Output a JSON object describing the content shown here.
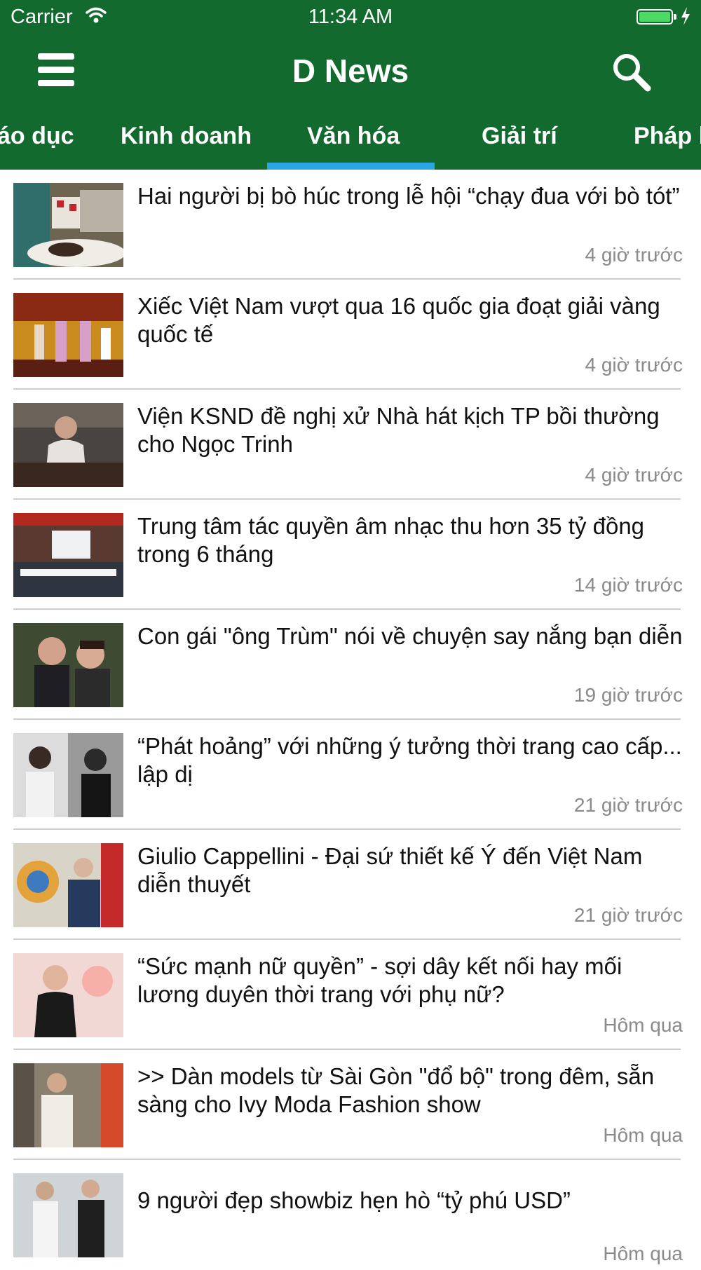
{
  "status_bar": {
    "carrier": "Carrier",
    "time": "11:34 AM"
  },
  "header": {
    "title": "D News"
  },
  "tabs": [
    {
      "label": "áo dục"
    },
    {
      "label": "Kinh doanh"
    },
    {
      "label": "Văn hóa"
    },
    {
      "label": "Giải trí"
    },
    {
      "label": "Pháp l"
    }
  ],
  "selected_tab": "Văn hóa",
  "colors": {
    "header_bg": "#126a2e",
    "tab_indicator": "#29a5e6",
    "time_text": "#8a8a8a"
  },
  "articles": [
    {
      "title": "Hai người bị bò húc trong lễ hội “chạy đua với bò tót”",
      "time": "4 giờ trước"
    },
    {
      "title": "Xiếc Việt Nam vượt qua 16 quốc gia đoạt giải vàng quốc tế",
      "time": "4 giờ trước"
    },
    {
      "title": "Viện KSND đề nghị xử Nhà hát kịch TP bồi thường cho Ngọc Trinh",
      "time": "4 giờ trước"
    },
    {
      "title": "Trung tâm tác quyền âm nhạc thu hơn 35 tỷ đồng trong 6 tháng",
      "time": "14 giờ trước"
    },
    {
      "title": "Con gái \"ông Trùm\" nói về chuyện say nắng bạn diễn",
      "time": "19 giờ trước"
    },
    {
      "title": "“Phát hoảng” với những ý tưởng thời trang cao cấp... lập dị",
      "time": "21 giờ trước"
    },
    {
      "title": "Giulio Cappellini - Đại sứ thiết kế Ý đến Việt Nam diễn thuyết",
      "time": "21 giờ trước"
    },
    {
      "title": "“Sức mạnh nữ quyền” - sợi dây kết nối hay mối lương duyên thời trang với phụ nữ?",
      "time": "Hôm qua"
    },
    {
      "title": ">> Dàn models từ Sài Gòn \"đổ bộ\" trong đêm, sẵn sàng cho Ivy Moda Fashion show",
      "time": "Hôm qua"
    },
    {
      "title": "9 người đẹp showbiz hẹn hò “tỷ phú USD”",
      "time": "Hôm qua"
    }
  ]
}
